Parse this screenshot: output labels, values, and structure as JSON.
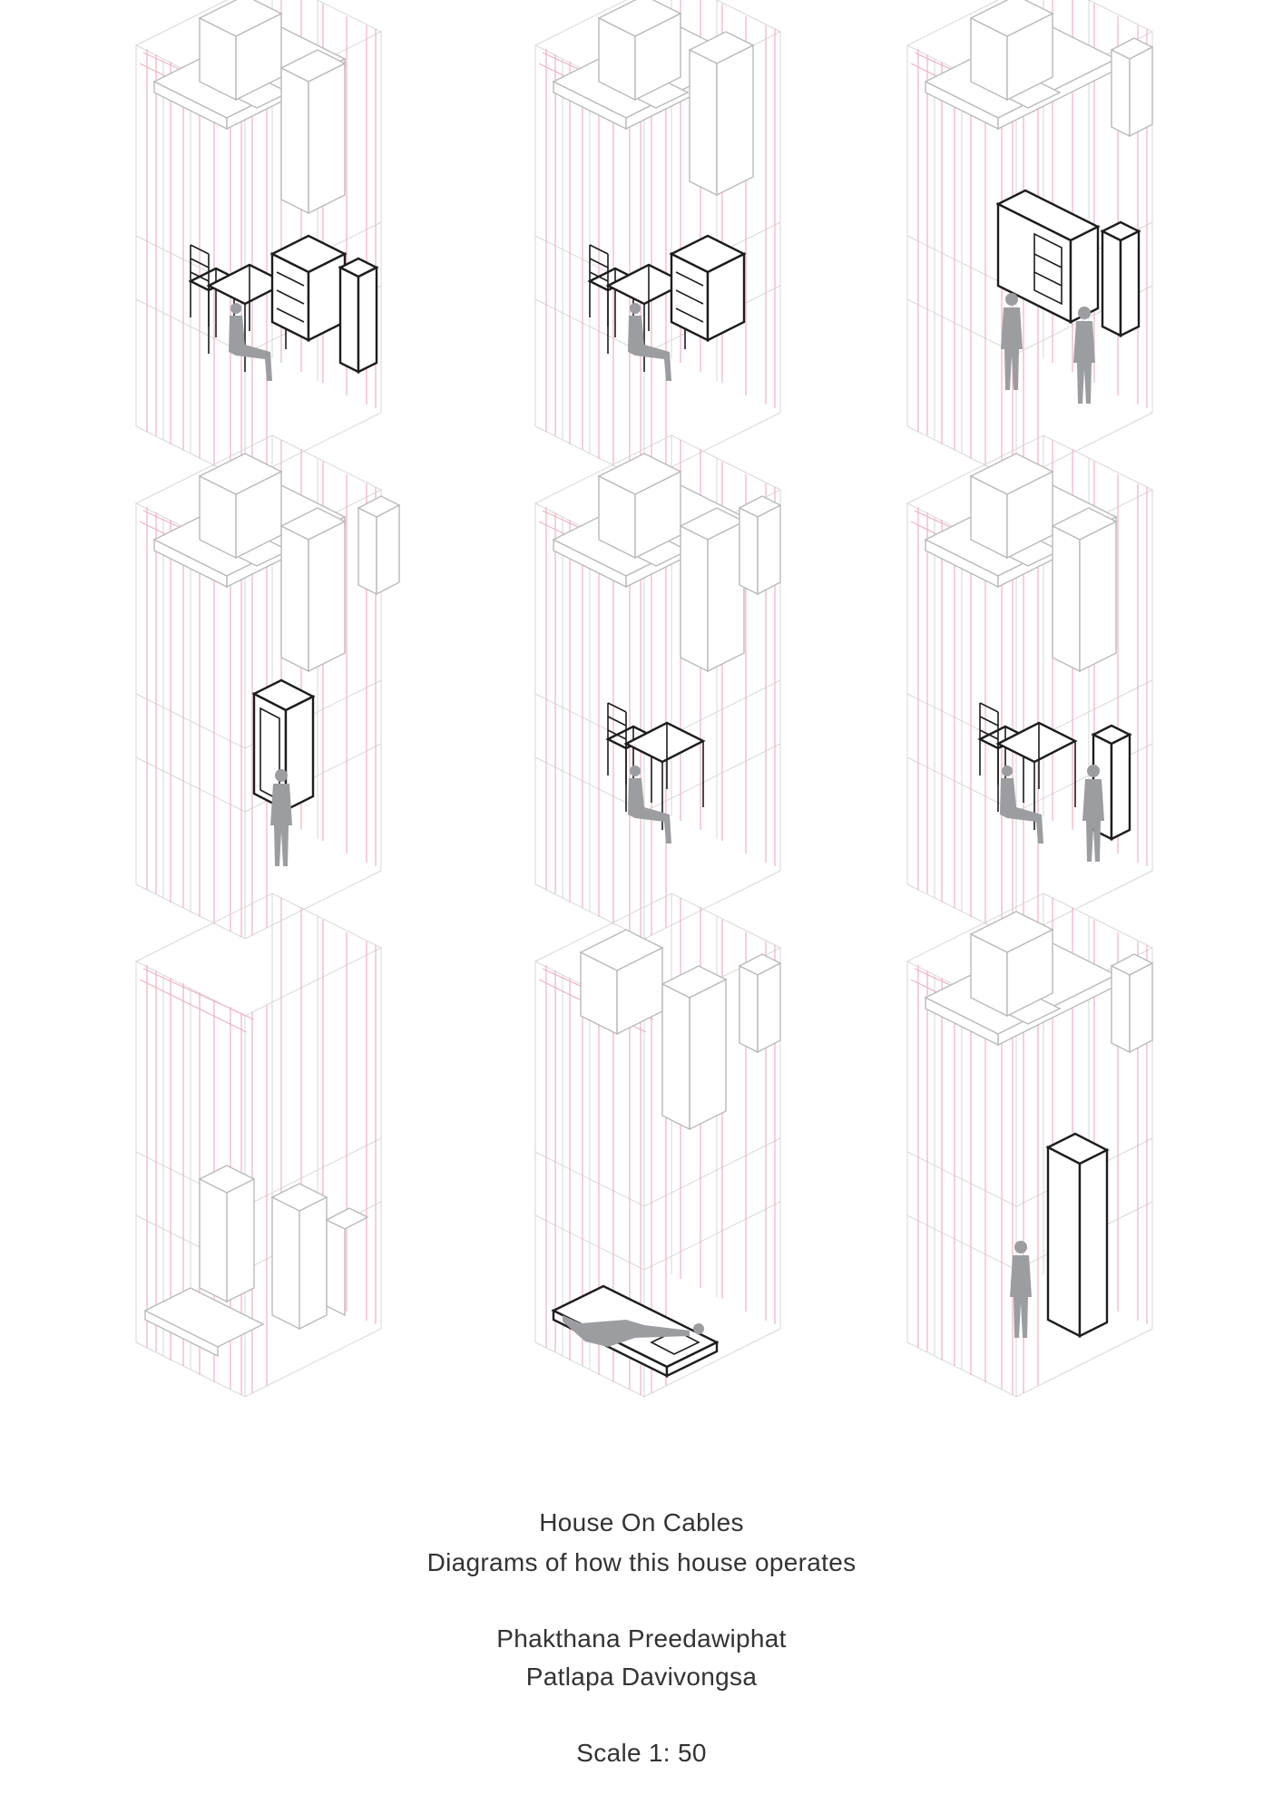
{
  "captions": {
    "title": "House On Cables",
    "subtitle": "Diagrams of how this house operates",
    "author_1": "Phakthana Preedawiphat",
    "author_2": "Patlapa Davivongsa",
    "scale": "Scale 1: 50"
  },
  "colors": {
    "cable": "#f0b2c2",
    "grid": "#d7d7d7",
    "suspended_unit": "#b9b9b9",
    "active_unit": "#1d1d1d",
    "figure": "#9b9da1",
    "text": "#333333"
  },
  "panels": [
    {
      "id": "p1",
      "active": [
        "chair",
        "table",
        "cabinet",
        "column"
      ],
      "people": 1
    },
    {
      "id": "p2",
      "active": [
        "chair",
        "table",
        "cabinet"
      ],
      "people": 1
    },
    {
      "id": "p3",
      "active": [
        "wardrobe",
        "column"
      ],
      "people": 2
    },
    {
      "id": "p4",
      "active": [
        "shower"
      ],
      "people": 1
    },
    {
      "id": "p5",
      "active": [
        "chair",
        "table"
      ],
      "people": 1
    },
    {
      "id": "p6",
      "active": [
        "chair",
        "table",
        "column"
      ],
      "people": 2
    },
    {
      "id": "p7",
      "active": [],
      "people": 0
    },
    {
      "id": "p8",
      "active": [
        "bed"
      ],
      "people": 1
    },
    {
      "id": "p9",
      "active": [
        "tower"
      ],
      "people": 1
    }
  ]
}
